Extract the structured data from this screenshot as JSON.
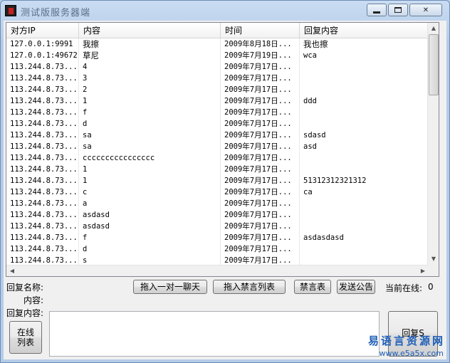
{
  "window": {
    "title": "测试版服务器端",
    "min_label": "",
    "max_label": "",
    "close_label": "✕"
  },
  "list": {
    "columns": [
      "对方IP",
      "内容",
      "时间",
      "回复内容"
    ],
    "rows": [
      [
        "127.0.0.1:9991",
        "我擦",
        "2009年8月18日...",
        "我也擦"
      ],
      [
        "127.0.0.1:49672",
        "草尼",
        "2009年7月19日...",
        "wca"
      ],
      [
        "113.244.8.73...",
        "4",
        "2009年7月17日...",
        ""
      ],
      [
        "113.244.8.73...",
        "3",
        "2009年7月17日...",
        ""
      ],
      [
        "113.244.8.73...",
        "2",
        "2009年7月17日...",
        ""
      ],
      [
        "113.244.8.73...",
        "1",
        "2009年7月17日...",
        "ddd"
      ],
      [
        "113.244.8.73...",
        "f",
        "2009年7月17日...",
        ""
      ],
      [
        "113.244.8.73...",
        "d",
        "2009年7月17日...",
        ""
      ],
      [
        "113.244.8.73...",
        "sa",
        "2009年7月17日...",
        "sdasd"
      ],
      [
        "113.244.8.73...",
        "sa",
        "2009年7月17日...",
        "asd"
      ],
      [
        "113.244.8.73...",
        "cccccccccccccccc",
        "2009年7月17日...",
        ""
      ],
      [
        "113.244.8.73...",
        "1",
        "2009年7月17日...",
        ""
      ],
      [
        "113.244.8.73...",
        "1",
        "2009年7月17日...",
        "51312312321312"
      ],
      [
        "113.244.8.73...",
        "c",
        "2009年7月17日...",
        "ca"
      ],
      [
        "113.244.8.73...",
        "a",
        "2009年7月17日...",
        ""
      ],
      [
        "113.244.8.73...",
        "asdasd",
        "2009年7月17日...",
        ""
      ],
      [
        "113.244.8.73...",
        "asdasd",
        "2009年7月17日...",
        ""
      ],
      [
        "113.244.8.73...",
        "f",
        "2009年7月17日...",
        "asdasdasd"
      ],
      [
        "113.244.8.73...",
        "d",
        "2009年7月17日...",
        ""
      ],
      [
        "113.244.8.73...",
        "s",
        "2009年7月17日...",
        ""
      ]
    ]
  },
  "form": {
    "reply_name_label": "回复名称:",
    "content_label": "内容:",
    "reply_content_label": "回复内容:",
    "online_label": "当前在线:",
    "online_count": "0"
  },
  "buttons": {
    "private_chat": "拖入一对一聊天",
    "ban_list": "拖入禁言列表",
    "ban_table": "禁言表",
    "announce": "发送公告",
    "online_list_line1": "在线",
    "online_list_line2": "列表",
    "reply": "回复S"
  },
  "watermark": {
    "text": "易语言资源网",
    "url": "www.e5a5x.com"
  },
  "colors": {
    "titlebar": "#c9dcf2",
    "client_bg": "#f0f0f0",
    "watermark": "#1f5fb8"
  }
}
